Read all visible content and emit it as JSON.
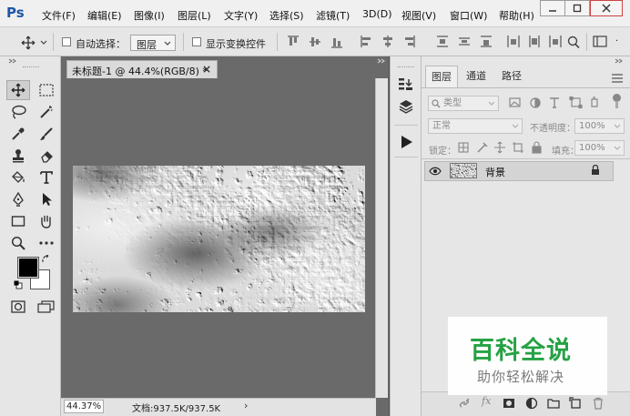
{
  "app": {
    "logo": "Ps"
  },
  "menu": [
    "文件(F)",
    "编辑(E)",
    "图像(I)",
    "图层(L)",
    "文字(Y)",
    "选择(S)",
    "滤镜(T)",
    "3D(D)",
    "视图(V)",
    "窗口(W)",
    "帮助(H)"
  ],
  "options": {
    "auto_select_label": "自动选择：",
    "auto_select_value": "图层",
    "show_transform_label": "显示变换控件"
  },
  "document": {
    "tab_title": "未标题-1 @ 44.4%(RGB/8) *",
    "tab_close": "×",
    "zoom": "44.37%",
    "doc_info": "文档:937.5K/937.5K",
    "status_arrow": "›"
  },
  "layers_panel": {
    "tabs": [
      "图层",
      "通道",
      "路径"
    ],
    "filter_kind": "类型",
    "blend_mode": "正常",
    "opacity_label": "不透明度：",
    "opacity_value": "100%",
    "lock_label": "锁定：",
    "fill_label": "填充：",
    "fill_value": "100%",
    "layers": [
      {
        "name": "背景",
        "visible": true,
        "locked": true
      }
    ]
  },
  "watermark": {
    "title": "百科全说",
    "subtitle": "助你轻松解决"
  },
  "colors": {
    "watermark_green": "#25a244",
    "foreground": "#000000",
    "background": "#ffffff"
  }
}
